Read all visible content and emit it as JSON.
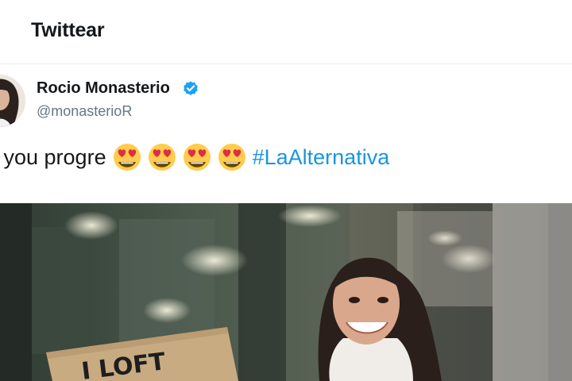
{
  "header": {
    "title": "Twittear"
  },
  "tweet": {
    "author": {
      "display_name": "Rocio Monasterio",
      "handle": "@monasterioR",
      "verified": true
    },
    "text_prefix": "ft you progre",
    "emoji_count": 4,
    "emoji": "smiling-face-with-heart-eyes",
    "hashtag": "#LaAlternativa"
  },
  "media": {
    "sign_text": "I LOFT"
  },
  "colors": {
    "link": "#1b95e0",
    "verified": "#1da1f2",
    "secondary_text": "#657786",
    "divider": "#e6ecf0"
  }
}
